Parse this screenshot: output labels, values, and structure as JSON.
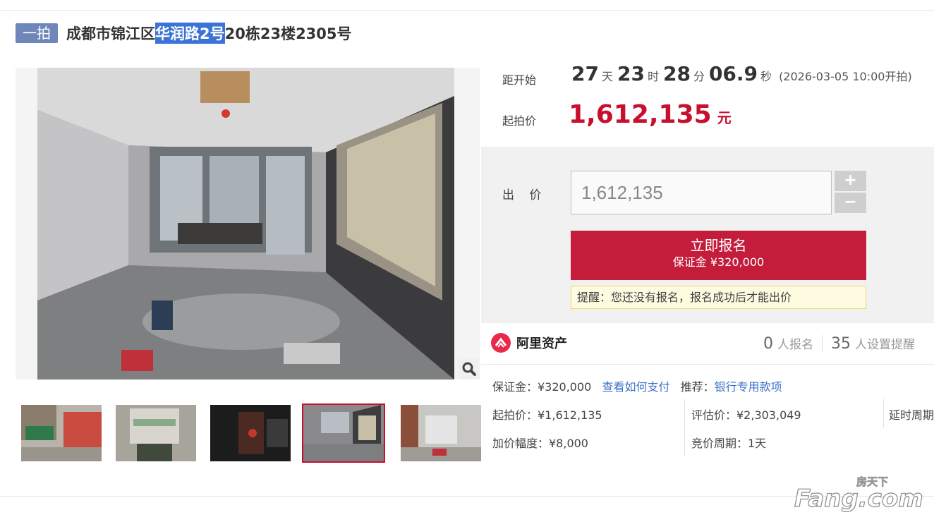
{
  "header": {
    "badge": "一拍",
    "title_pre": "成都市锦江区",
    "title_highlight": "华润路2号",
    "title_post": "20栋23楼2305号"
  },
  "countdown": {
    "label": "距开始",
    "days": "27",
    "days_unit": "天",
    "hours": "23",
    "hours_unit": "时",
    "minutes": "28",
    "minutes_unit": "分",
    "seconds": "06.9",
    "seconds_unit": "秒",
    "start_note": "(2026-03-05 10:00开拍)"
  },
  "start_price": {
    "label": "起拍价",
    "value": "1,612,135",
    "unit": "元"
  },
  "bid": {
    "label": "出 价",
    "input_value": "1,612,135",
    "plus": "+",
    "minus": "−",
    "signup_label": "立即报名",
    "signup_deposit": "保证金 ¥320,000",
    "notice": "提醒：您还没有报名，报名成功后才能出价"
  },
  "platform": {
    "name": "阿里资产",
    "signups_count": "0",
    "signups_label": "人报名",
    "reminders_count": "35",
    "reminders_label": "人设置提醒"
  },
  "details": {
    "deposit": "保证金：¥320,000",
    "how_to_pay": "查看如何支付",
    "recommend_label": "推荐：",
    "recommend_link": "银行专用款项",
    "start_price": "起拍价：¥1,612,135",
    "appraisal": "评估价：¥2,303,049",
    "extension": "延时周期",
    "increment": "加价幅度：¥8,000",
    "bid_period": "竞价周期：1天"
  },
  "colors": {
    "accent_red": "#c8102e",
    "badge_blue": "#6f86b8",
    "link_blue": "#3b73c9",
    "highlight_blue": "#3b73d6"
  },
  "watermark": {
    "top_text": "房天下",
    "main_text": "Fang.com"
  },
  "icons": {
    "zoom": "magnifier-icon",
    "platform_logo": "ali-asset-logo-icon"
  }
}
